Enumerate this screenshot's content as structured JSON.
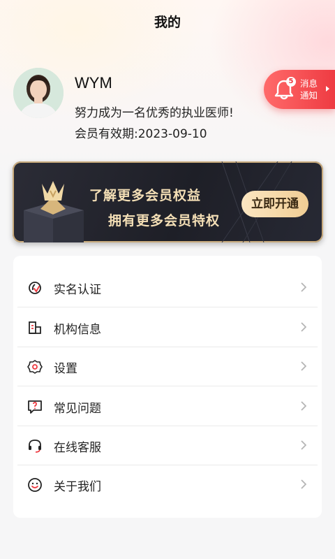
{
  "header": {
    "title": "我的"
  },
  "profile": {
    "name": "WYM",
    "motto": "努力成为一名优秀的执业医师!",
    "expiry_label": "会员有效期:",
    "expiry_date": "2023-09-10"
  },
  "notification": {
    "count": "5",
    "line1": "消息",
    "line2": "通知"
  },
  "vip_banner": {
    "line1": "了解更多会员权益",
    "line2": "拥有更多会员特权",
    "button_label": "立即开通"
  },
  "menu": {
    "items": [
      {
        "label": "实名认证",
        "icon": "id-verify-icon"
      },
      {
        "label": "机构信息",
        "icon": "building-icon"
      },
      {
        "label": "设置",
        "icon": "gear-icon"
      },
      {
        "label": "常见问题",
        "icon": "question-icon"
      },
      {
        "label": "在线客服",
        "icon": "headset-icon"
      },
      {
        "label": "关于我们",
        "icon": "smile-icon"
      }
    ]
  },
  "colors": {
    "accent": "#ee3b42",
    "gold": "#f4dfb6",
    "banner_bg": "#1e1f27"
  }
}
